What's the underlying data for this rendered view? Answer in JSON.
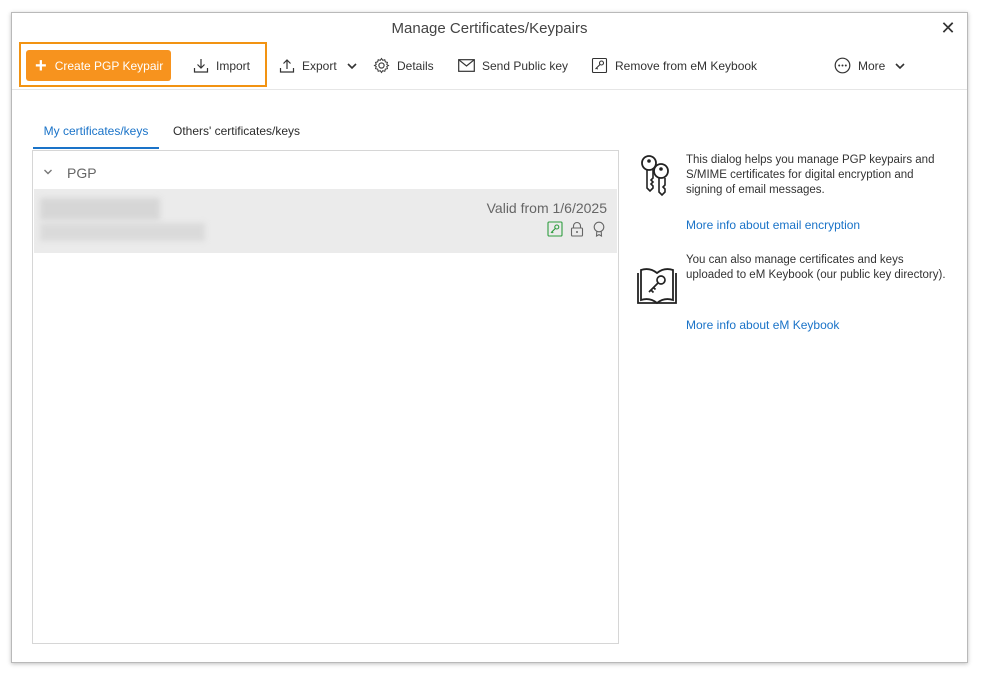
{
  "window": {
    "title": "Manage Certificates/Keypairs"
  },
  "toolbar": {
    "create_label": "Create PGP Keypair",
    "import_label": "Import",
    "export_label": "Export",
    "details_label": "Details",
    "send_label": "Send Public key",
    "remove_label": "Remove from eM Keybook",
    "more_label": "More"
  },
  "tabs": [
    {
      "label": "My certificates/keys",
      "active": true
    },
    {
      "label": "Others' certificates/keys",
      "active": false
    }
  ],
  "list": {
    "group": "PGP",
    "rows": [
      {
        "valid_text": "Valid from 1/6/2025"
      }
    ]
  },
  "info": {
    "text1": "This dialog helps you manage PGP keypairs and S/MIME certificates for digital encryption and signing of email messages.",
    "link1": "More info about email encryption",
    "text2": "You can also manage certificates and keys uploaded to eM Keybook (our public key directory).",
    "link2": "More info about eM Keybook"
  },
  "colors": {
    "accent": "#f7931e",
    "link": "#1a73c8",
    "highlight": "#f29312"
  },
  "icons": [
    "close-icon",
    "plus-icon",
    "import-icon",
    "export-icon",
    "chevron-down-icon",
    "gear-icon",
    "envelope-icon",
    "keybook-icon",
    "more-icon",
    "keys-icon",
    "book-key-icon",
    "key-badge-icon",
    "lock-icon",
    "award-icon"
  ]
}
